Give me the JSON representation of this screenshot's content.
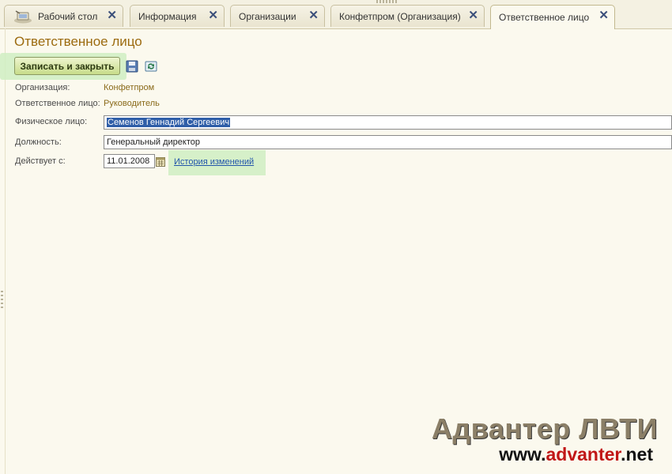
{
  "tabs": [
    {
      "label": "Рабочий стол",
      "icon": "desktop-icon"
    },
    {
      "label": "Информация"
    },
    {
      "label": "Организации"
    },
    {
      "label": "Конфетпром (Организация)"
    },
    {
      "label": "Ответственное лицо",
      "active": true
    }
  ],
  "close_glyph": "✕",
  "form": {
    "title": "Ответственное лицо",
    "save_close_label": "Записать и закрыть",
    "tool_icons": [
      "save-icon",
      "refresh-icon"
    ],
    "fields": {
      "organization": {
        "label": "Организация:",
        "value": "Конфетпром"
      },
      "responsible": {
        "label": "Ответственное лицо:",
        "value": "Руководитель"
      },
      "person": {
        "label": "Физическое лицо:",
        "value": "Семенов Геннадий Сергеевич"
      },
      "position": {
        "label": "Должность:",
        "value": "Генеральный директор"
      },
      "valid_from": {
        "label": "Действует с:",
        "value": "11.01.2008"
      }
    },
    "history_link": "История изменений"
  },
  "watermark": {
    "line1": "Адвантер ЛВТИ",
    "line2_prefix": "www.",
    "line2_brand": "advanter",
    "line2_suffix": ".net"
  },
  "colors": {
    "accent_title": "#9c6b10",
    "highlight": "#cfeec2",
    "selection": "#2f5ea8",
    "watermark_red": "#c11717"
  }
}
